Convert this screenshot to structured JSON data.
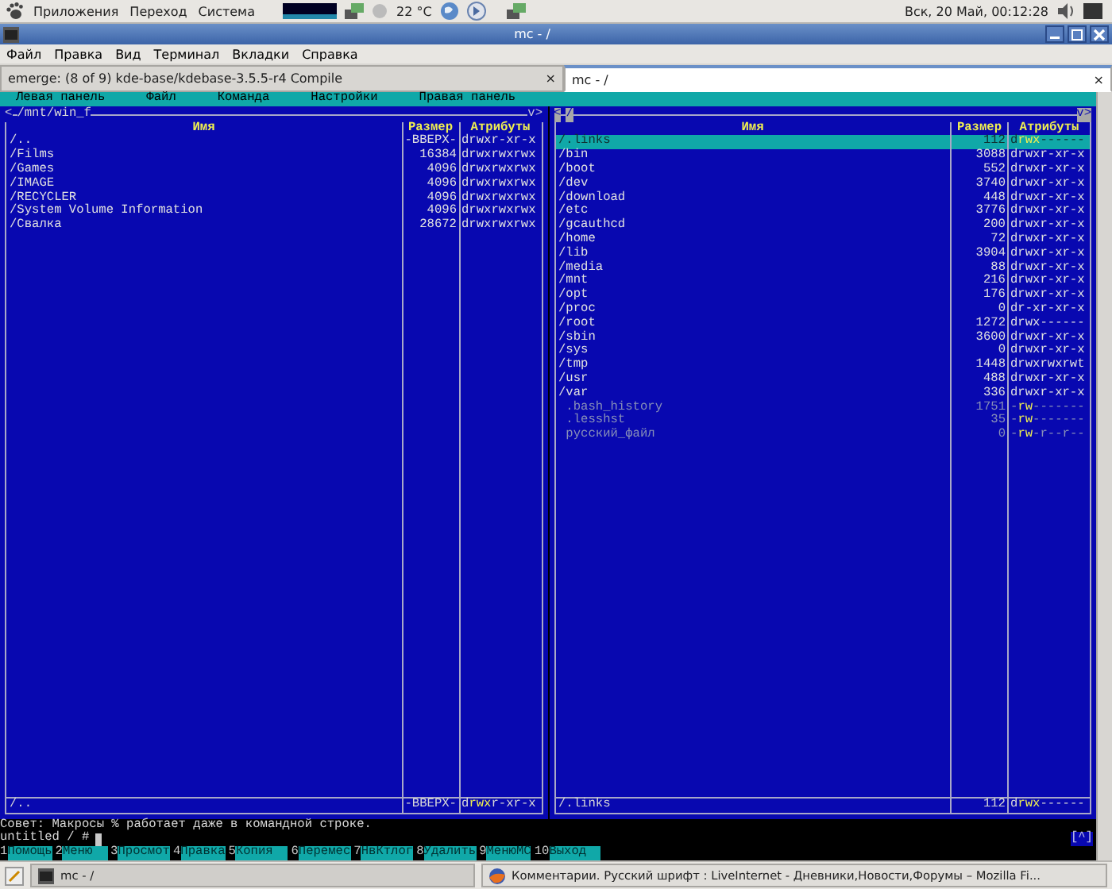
{
  "top_panel": {
    "menus": [
      "Приложения",
      "Переход",
      "Система"
    ],
    "temperature": "22 °C",
    "clock": "Вск, 20 Май, 00:12:28"
  },
  "window": {
    "title": "mc - /"
  },
  "menubar": [
    "Файл",
    "Правка",
    "Вид",
    "Терминал",
    "Вкладки",
    "Справка"
  ],
  "tabs": [
    {
      "label": "emerge: (8 of 9) kde-base/kdebase-3.5.5-r4 Compile",
      "close": "×",
      "selected": false
    },
    {
      "label": "mc - /",
      "close": "×",
      "selected": true
    }
  ],
  "mc_menu": [
    "Левая панель",
    "Файл",
    "Команда",
    "Настройки",
    "Правая панель"
  ],
  "panels": [
    {
      "active": false,
      "history": "<",
      "path": "/mnt/win_f",
      "tree": "v>",
      "columns": [
        "Имя",
        "Размер",
        "Атрибуты"
      ],
      "rows": [
        {
          "name": "/..",
          "size": "-ВВЕРХ-",
          "attributes": "drwxr-xr-x",
          "kind": "dir",
          "selected": false
        },
        {
          "name": "/Films",
          "size": "16384",
          "attributes": "drwxrwxrwx",
          "kind": "dir",
          "selected": false
        },
        {
          "name": "/Games",
          "size": "4096",
          "attributes": "drwxrwxrwx",
          "kind": "dir",
          "selected": false
        },
        {
          "name": "/IMAGE",
          "size": "4096",
          "attributes": "drwxrwxrwx",
          "kind": "dir",
          "selected": false
        },
        {
          "name": "/RECYCLER",
          "size": "4096",
          "attributes": "drwxrwxrwx",
          "kind": "dir",
          "selected": false
        },
        {
          "name": "/System Volume Information",
          "size": "4096",
          "attributes": "drwxrwxrwx",
          "kind": "dir",
          "selected": false
        },
        {
          "name": "/Свалка",
          "size": "28672",
          "attributes": "drwxrwxrwx",
          "kind": "dir",
          "selected": false
        }
      ],
      "status": {
        "name": "/..",
        "size": "-ВВЕРХ-",
        "attributes": "d**rwx**r-xr-x"
      }
    },
    {
      "active": true,
      "history": "<",
      "path": "/",
      "tree": "v>",
      "columns": [
        "Имя",
        "Размер",
        "Атрибуты"
      ],
      "rows": [
        {
          "name": "/.links",
          "size": "112",
          "attributes": "d**rwx**------",
          "kind": "dir",
          "selected": true
        },
        {
          "name": "/bin",
          "size": "3088",
          "attributes": "drwxr-xr-x",
          "kind": "dir",
          "selected": false
        },
        {
          "name": "/boot",
          "size": "552",
          "attributes": "drwxr-xr-x",
          "kind": "dir",
          "selected": false
        },
        {
          "name": "/dev",
          "size": "3740",
          "attributes": "drwxr-xr-x",
          "kind": "dir",
          "selected": false
        },
        {
          "name": "/download",
          "size": "448",
          "attributes": "drwxr-xr-x",
          "kind": "dir",
          "selected": false
        },
        {
          "name": "/etc",
          "size": "3776",
          "attributes": "drwxr-xr-x",
          "kind": "dir",
          "selected": false
        },
        {
          "name": "/gcauthcd",
          "size": "200",
          "attributes": "drwxr-xr-x",
          "kind": "dir",
          "selected": false
        },
        {
          "name": "/home",
          "size": "72",
          "attributes": "drwxr-xr-x",
          "kind": "dir",
          "selected": false
        },
        {
          "name": "/lib",
          "size": "3904",
          "attributes": "drwxr-xr-x",
          "kind": "dir",
          "selected": false
        },
        {
          "name": "/media",
          "size": "88",
          "attributes": "drwxr-xr-x",
          "kind": "dir",
          "selected": false
        },
        {
          "name": "/mnt",
          "size": "216",
          "attributes": "drwxr-xr-x",
          "kind": "dir",
          "selected": false
        },
        {
          "name": "/opt",
          "size": "176",
          "attributes": "drwxr-xr-x",
          "kind": "dir",
          "selected": false
        },
        {
          "name": "/proc",
          "size": "0",
          "attributes": "dr-xr-xr-x",
          "kind": "dir",
          "selected": false
        },
        {
          "name": "/root",
          "size": "1272",
          "attributes": "drwx------",
          "kind": "dir",
          "selected": false
        },
        {
          "name": "/sbin",
          "size": "3600",
          "attributes": "drwxr-xr-x",
          "kind": "dir",
          "selected": false
        },
        {
          "name": "/sys",
          "size": "0",
          "attributes": "drwxr-xr-x",
          "kind": "dir",
          "selected": false
        },
        {
          "name": "/tmp",
          "size": "1448",
          "attributes": "drwxrwxrwt",
          "kind": "dir",
          "selected": false
        },
        {
          "name": "/usr",
          "size": "488",
          "attributes": "drwxr-xr-x",
          "kind": "dir",
          "selected": false
        },
        {
          "name": "/var",
          "size": "336",
          "attributes": "drwxr-xr-x",
          "kind": "dir",
          "selected": false
        },
        {
          "name": " .bash_history",
          "size": "1751",
          "attributes": "-**rw**-------",
          "kind": "hidden",
          "selected": false
        },
        {
          "name": " .lesshst",
          "size": "35",
          "attributes": "-**rw**-------",
          "kind": "hidden",
          "selected": false
        },
        {
          "name": " русский_файл",
          "size": "0",
          "attributes": "-**rw**-r--r--",
          "kind": "hidden",
          "selected": false
        }
      ],
      "status": {
        "name": "/.links",
        "size": "112",
        "attributes": "d**rwx**------"
      }
    }
  ],
  "hint": "Совет: Макросы % работает даже в командной строке.",
  "prompt": "untitled / #",
  "corner": "[^]",
  "function_keys": [
    {
      "number": "1",
      "label": "Помощь"
    },
    {
      "number": "2",
      "label": "Меню  "
    },
    {
      "number": "3",
      "label": "Просмот"
    },
    {
      "number": "4",
      "label": "Правка"
    },
    {
      "number": "5",
      "label": "Копия  "
    },
    {
      "number": "6",
      "label": "Перемес"
    },
    {
      "number": "7",
      "label": "НвКтлог"
    },
    {
      "number": "8",
      "label": "Удалить"
    },
    {
      "number": "9",
      "label": "МенюМС"
    },
    {
      "number": "10",
      "label": "Выход  "
    }
  ],
  "taskbar": [
    {
      "label": "mc - /",
      "selected": true
    },
    {
      "label": "Комментарии. Русский шрифт : LiveInternet - Дневники,Новости,Форумы – Mozilla Fi...",
      "selected": false
    }
  ]
}
